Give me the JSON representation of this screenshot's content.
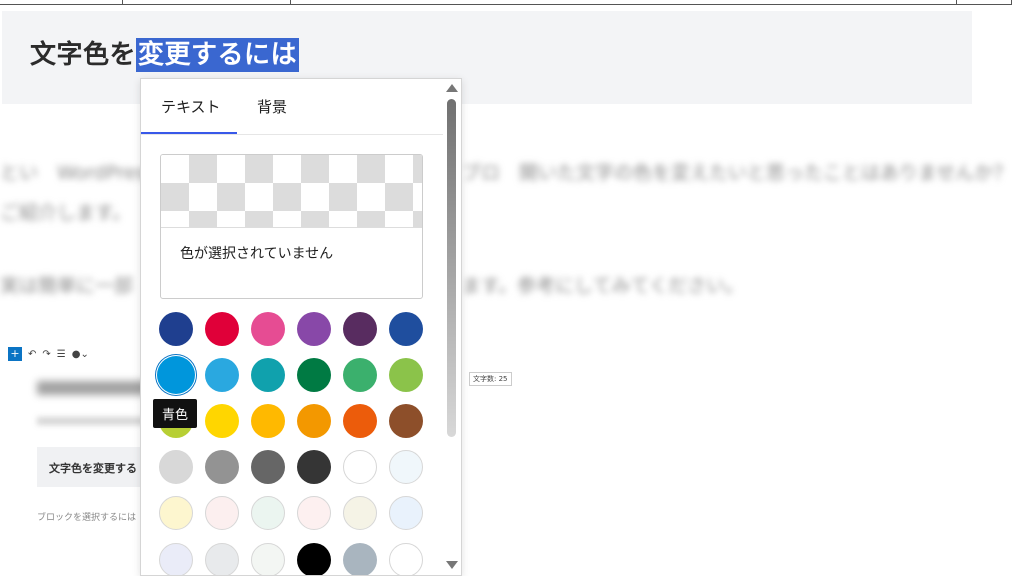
{
  "article": {
    "heading_plain": "文字色を",
    "heading_selected": "変更するには",
    "blurred_para1_a": "とい　WordPressで",
    "blurred_para1_b": "ブロ　開いた文字の色を変えたいと思ったことはありませんか？",
    "blurred_para1_c": "ご紹介します。",
    "blurred_para2_a": "実は簡単に一部",
    "blurred_para2_b": "ます。参考にしてみてください。"
  },
  "editor_thumb": {
    "count_label": "文字数: 25",
    "block_text": "文字色を変更する",
    "hint_text": "ブロックを選択するには"
  },
  "color_popover": {
    "tabs": [
      {
        "label": "テキスト",
        "active": true
      },
      {
        "label": "背景",
        "active": false
      }
    ],
    "preview_text": "色が選択されていません",
    "tooltip": "青色",
    "selected_color": "#0096dc",
    "swatches": [
      [
        "#1f3f8f",
        "#e00039",
        "#e64c93",
        "#8848a8",
        "#582c60",
        "#1f4e9e"
      ],
      [
        "#0096dc",
        "#2aa8e0",
        "#10a1ad",
        "#007a43",
        "#3bb06d",
        "#8bc34a"
      ],
      [
        "#b7cf34",
        "#ffd600",
        "#ffb900",
        "#f39800",
        "#ec5c0b",
        "#8d4f2a"
      ],
      [
        "#d8d8d8",
        "#939393",
        "#666666",
        "#353535",
        "#ffffff",
        "#f0f7fb"
      ],
      [
        "#fdf6cf",
        "#fcefef",
        "#ebf5f0",
        "#fdf0f0",
        "#f5f3e6",
        "#e9f2fc"
      ],
      [
        "#eaecf8",
        "#e8eaec",
        "#f3f6f3",
        "#000000",
        "#a9b5bf",
        "#ffffff"
      ]
    ]
  }
}
